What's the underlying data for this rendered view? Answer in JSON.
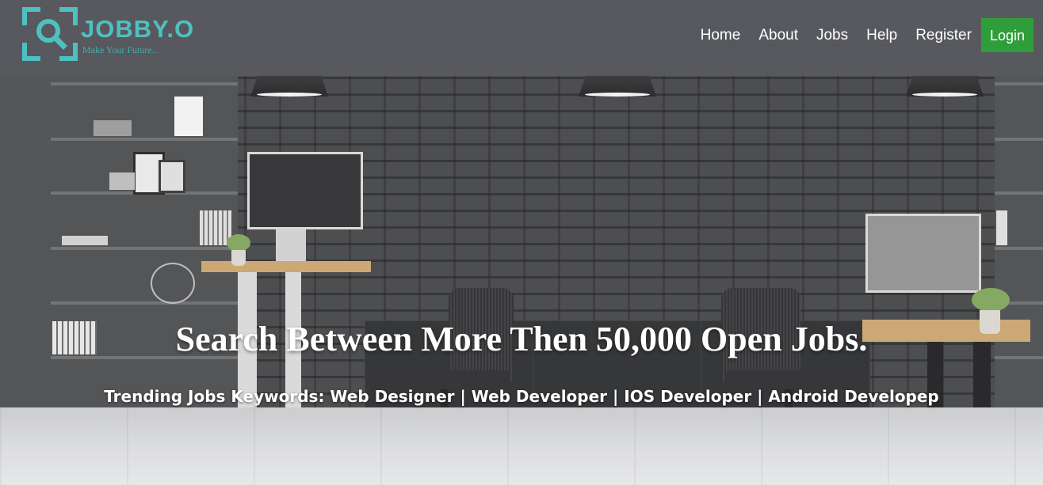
{
  "brand": {
    "name": "JOBBY.O",
    "tagline": "Make Your Future..."
  },
  "nav": {
    "items": [
      {
        "label": "Home"
      },
      {
        "label": "About"
      },
      {
        "label": "Jobs"
      },
      {
        "label": "Help"
      },
      {
        "label": "Register"
      }
    ],
    "login_label": "Login"
  },
  "hero": {
    "headline": "Search Between More Then 50,000 Open Jobs.",
    "trending": "Trending Jobs Keywords: Web Designer | Web Developer | IOS Developer | Android Developep"
  },
  "colors": {
    "brand_teal": "#4fc0c0",
    "login_green": "#2f9e3a",
    "header_bg": "#585a60"
  },
  "icons": {
    "logo_icon": "magnifier-in-brackets"
  }
}
